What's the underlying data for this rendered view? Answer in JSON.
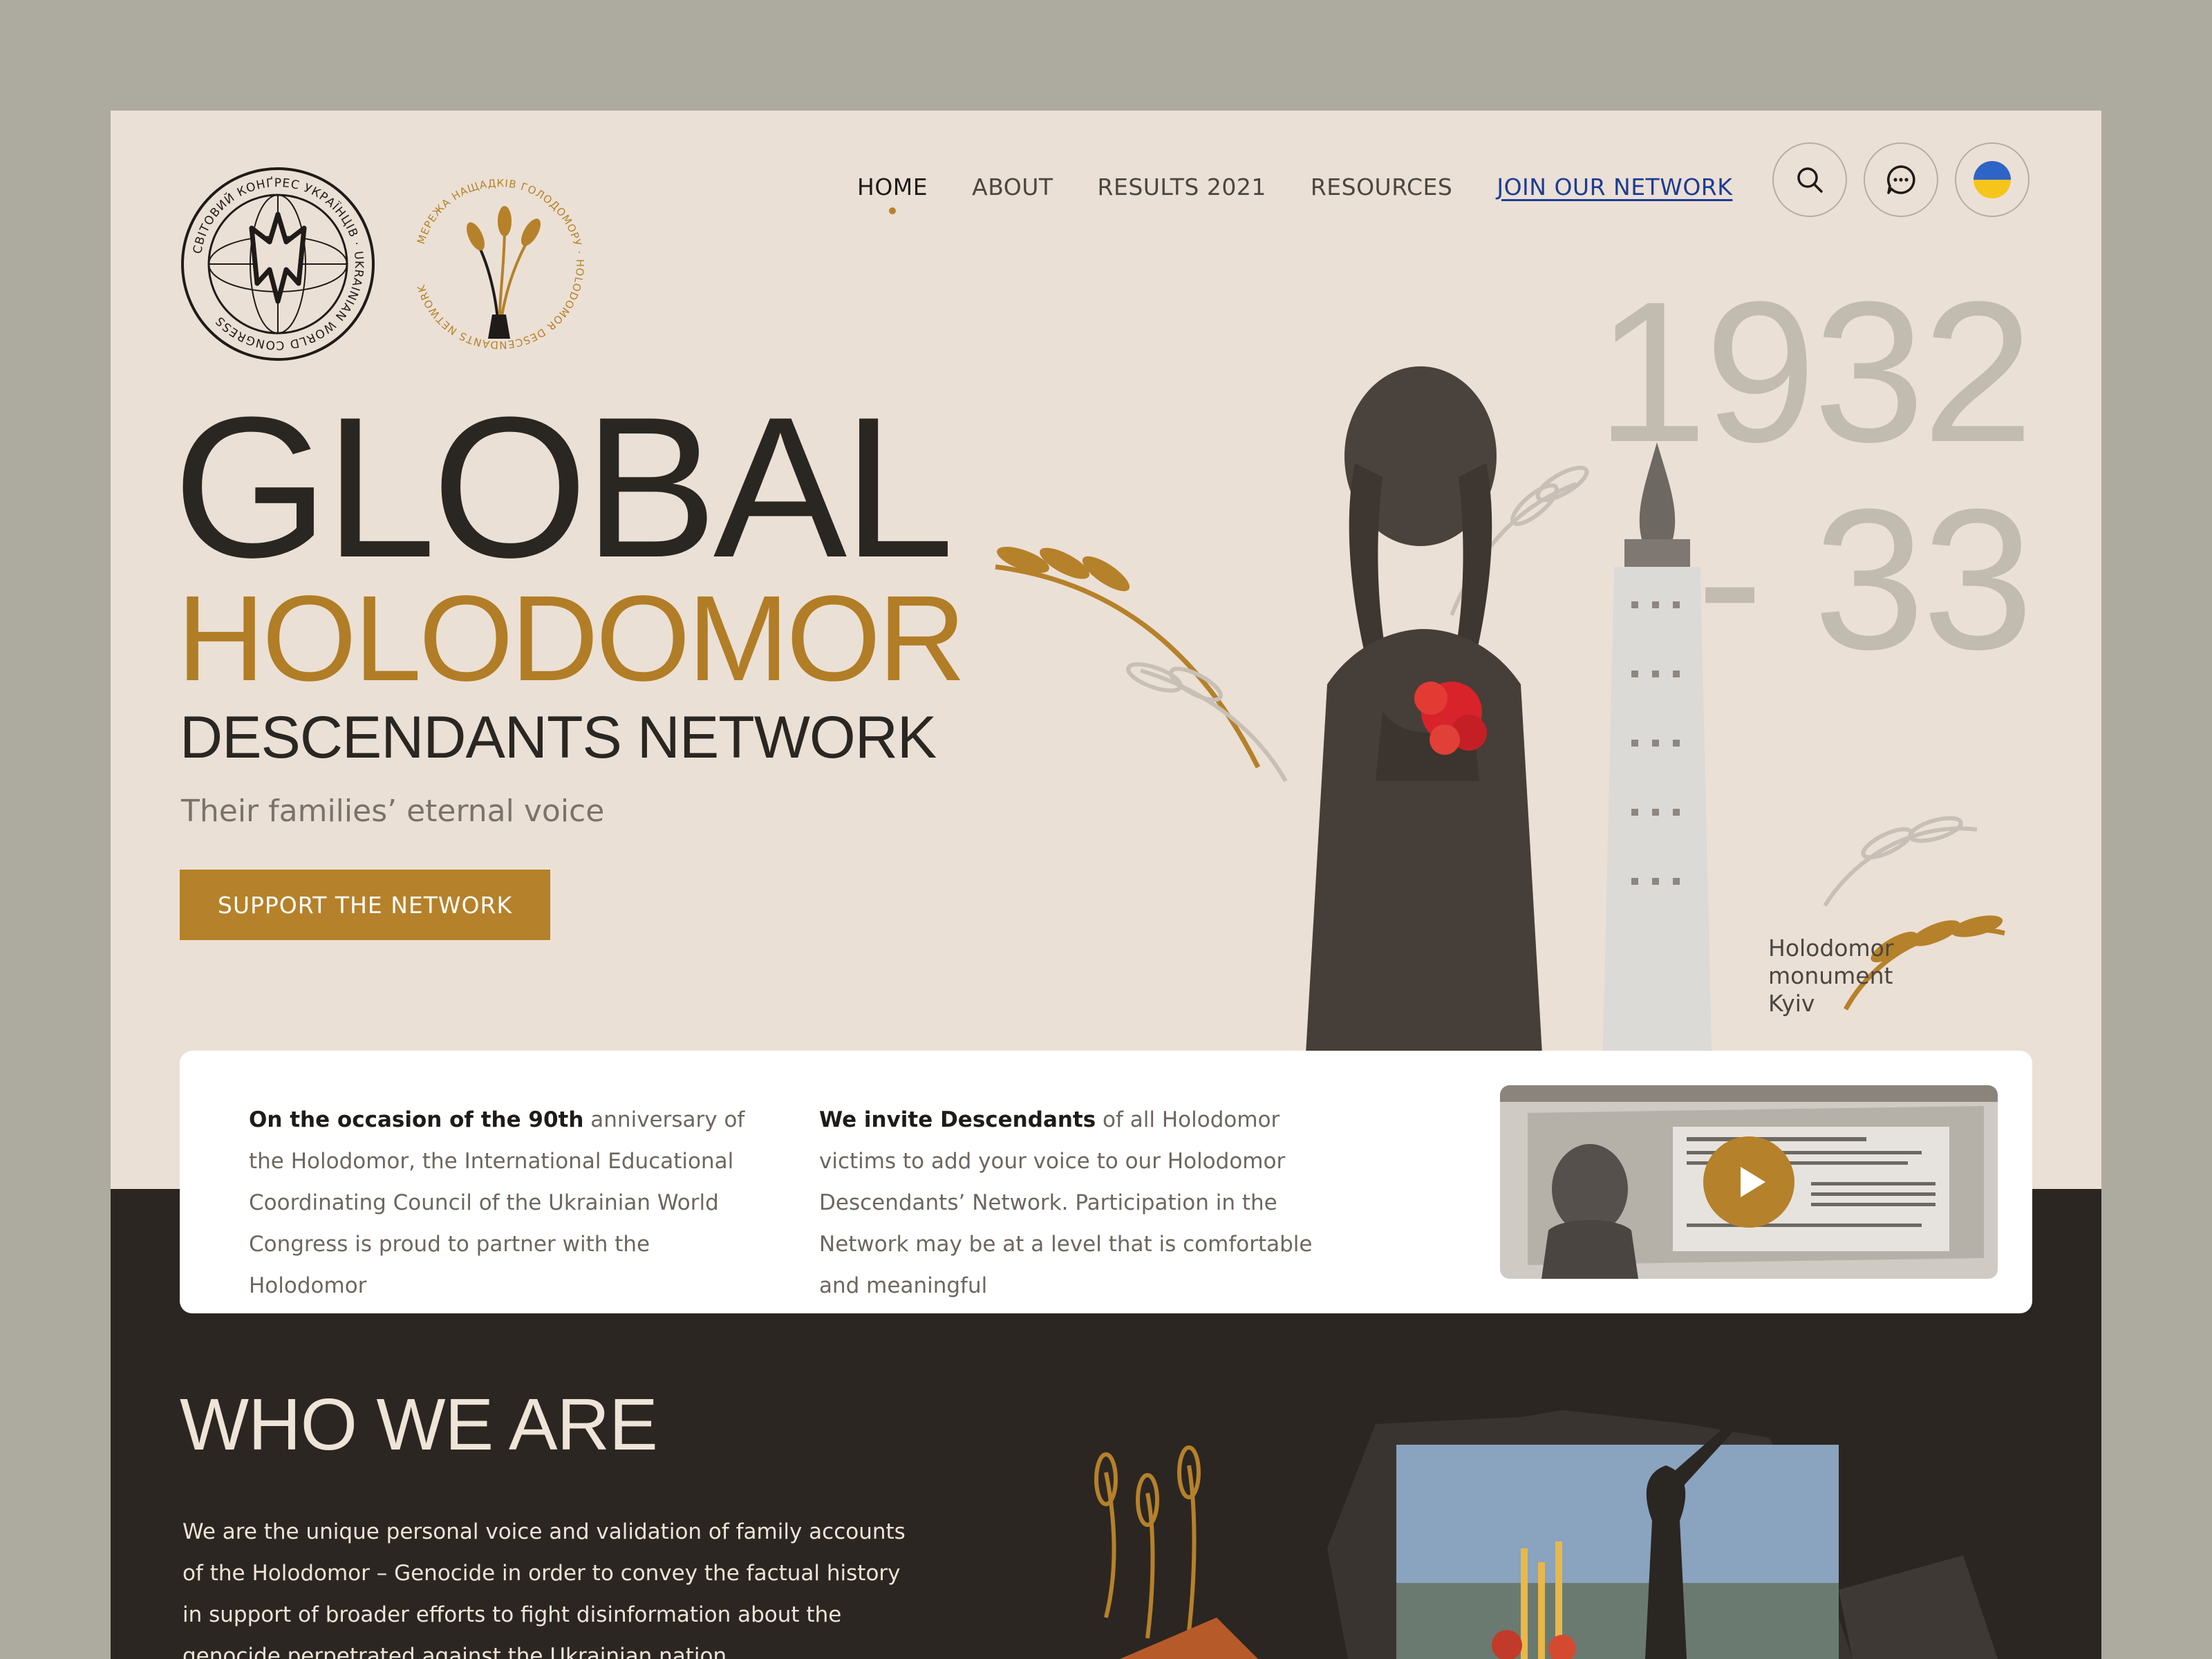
{
  "logos": {
    "uwc_ring_text": "СВІТОВИЙ КОНҐРЕС УКРАЇНЦІВ · UKRAINIAN WORLD CONGRESS",
    "hdn_ring_text": "МЕРЕЖА НАЩАДКІВ ГОЛОДОМОРУ · HOLODOMOR DESCENDANTS NETWORK"
  },
  "nav": {
    "items": [
      {
        "label": "HOME"
      },
      {
        "label": "ABOUT"
      },
      {
        "label": "RESULTS 2021"
      },
      {
        "label": "RESOURCES"
      },
      {
        "label": "JOIN OUR NETWORK"
      }
    ],
    "icons": [
      "search-icon",
      "chat-icon",
      "ukraine-flag-icon"
    ]
  },
  "hero": {
    "title_line1": "GLOBAL",
    "title_line2": "HOLODOMOR",
    "title_line3": "DESCENDANTS NETWORK",
    "tagline": "Their families’ eternal voice",
    "cta_label": "SUPPORT THE NETWORK",
    "year_line1": "1932",
    "year_line2": "- 33",
    "caption_line1": "Holodomor",
    "caption_line2": "monument",
    "caption_line3": "Kyiv"
  },
  "info": {
    "col1_lead": "On the occasion of the 90th",
    "col1_text": " anniversary of the Holodomor, the International Educational Coordinating Council of the Ukrainian World Congress is proud to partner with the Holodomor",
    "col2_lead": "We invite Descendants",
    "col2_text": " of all Holodomor victims to add your voice to our Holodomor Descendants’ Network. Participation in the Network may be at a level that is comfortable and meaningful"
  },
  "who": {
    "title": "WHO WE ARE",
    "body": "We are the unique personal voice and validation of family accounts of the Holodomor – Genocide in order to convey the factual history in support of broader efforts to fight disinformation about the genocide perpetrated against the Ukrainian nation."
  },
  "colors": {
    "background": "#adaa9f",
    "panel": "#ebe0d5",
    "dark": "#2b2622",
    "accent": "#b5812a",
    "link": "#1d3c93",
    "years": "#c2bbb0"
  }
}
